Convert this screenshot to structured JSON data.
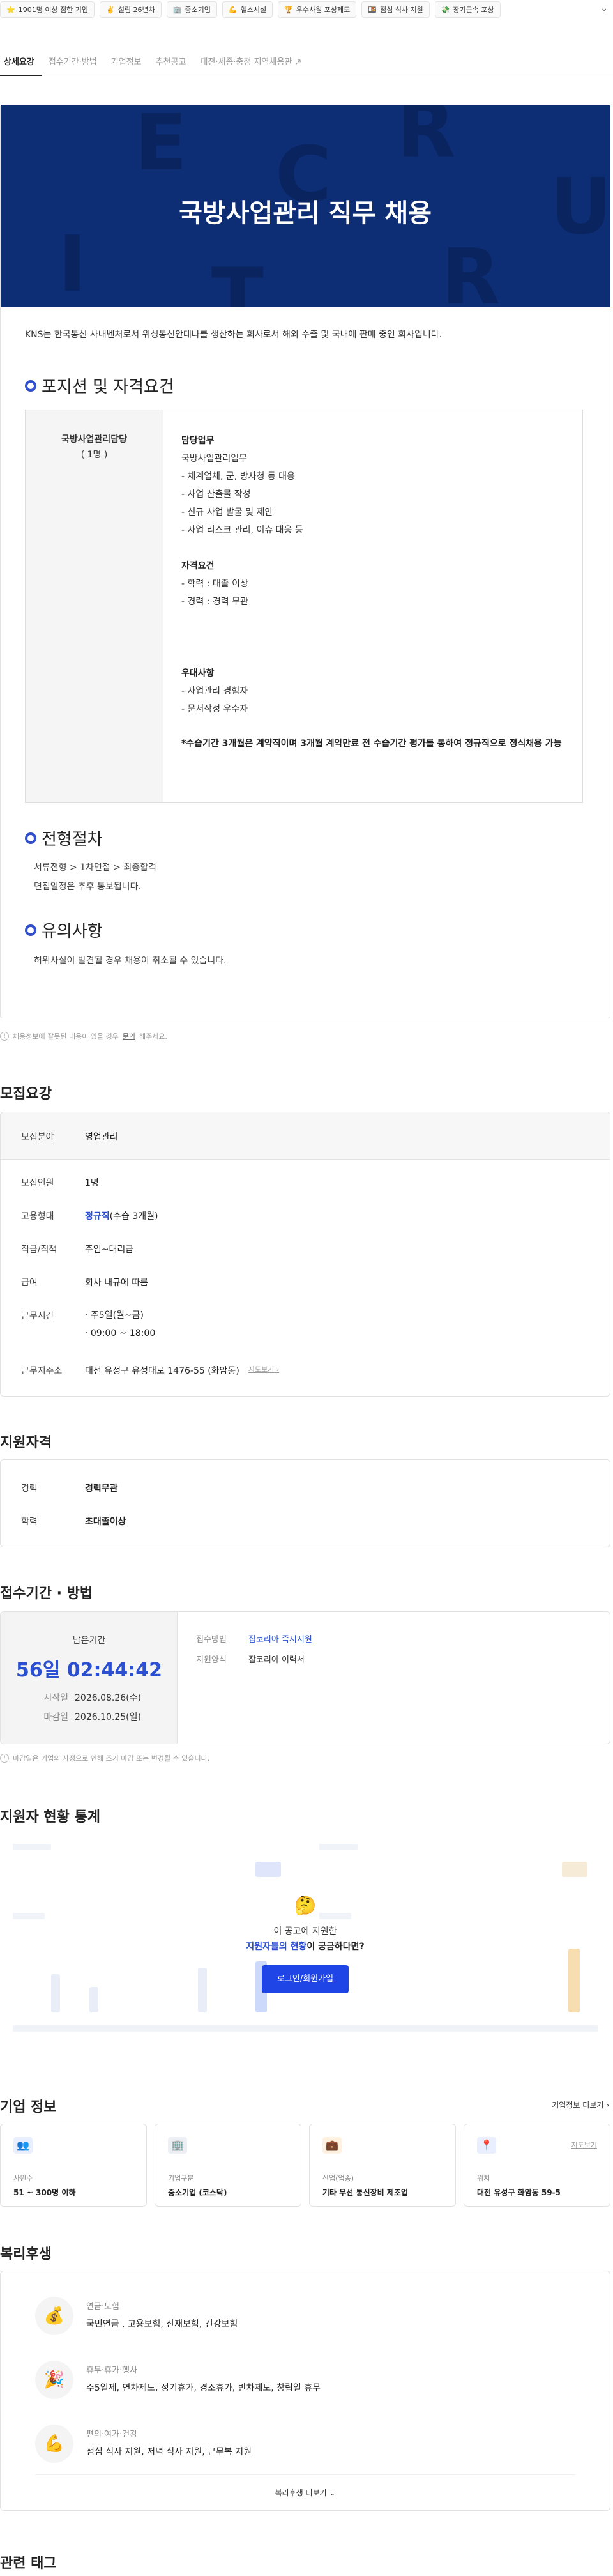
{
  "chips": [
    {
      "icon": "star-icon",
      "glyph": "⭐",
      "label": "1901명 이상 점한 기업"
    },
    {
      "icon": "hand-icon",
      "glyph": "✌️",
      "label": "설립 26년차"
    },
    {
      "icon": "building-icon",
      "glyph": "🏢",
      "label": "중소기업"
    },
    {
      "icon": "muscle-icon",
      "glyph": "💪",
      "label": "헬스시설"
    },
    {
      "icon": "trophy-icon",
      "glyph": "🏆",
      "label": "우수사원 포상제도"
    },
    {
      "icon": "meal-icon",
      "glyph": "🍱",
      "label": "점심 식사 지원"
    },
    {
      "icon": "money-icon",
      "glyph": "💸",
      "label": "장기근속 포상"
    }
  ],
  "tabs": [
    "상세요강",
    "접수기간·방법",
    "기업정보",
    "추천공고",
    "대전·세종·충청 지역채용관"
  ],
  "detail": {
    "banner_title": "국방사업관리 직무  채용",
    "intro": "KNS는 한국통신 사내벤처로서 위성통신안테나를 생산하는 회사로서 해외 수출 및 국내에 판매 중인 회사입니다.",
    "position_heading": "포지션 및 자격요건",
    "position_name": "국방사업관리담당",
    "position_count": "( 1명 )",
    "duty_title": "담당업무",
    "duty_lines": [
      "국방사업관리업무",
      "- 체계업체, 군, 방사청 등 대응",
      "- 사업 산출물 작성",
      "- 신규 사업 발굴 및 제안",
      "- 사업 리스크 관리, 이슈 대응 등"
    ],
    "qual_title": "자격요건",
    "qual_lines": [
      "- 학력 : 대졸 이상",
      "- 경력 : 경력 무관"
    ],
    "pref_title": "우대사항",
    "pref_lines": [
      "- 사업관리 경험자",
      "- 문서작성 우수자"
    ],
    "note": "*수습기간 3개월은 계약직이며 3개월 계약만료 전 수습기간 평가를 통하여 정규직으로 정식채용 가능",
    "process_heading": "전형절차",
    "process_lines": [
      "서류전형 > 1차면접 > 최종합격",
      "면접일정은 추후 통보됩니다."
    ],
    "caution_heading": "유의사항",
    "caution_lines": [
      "허위사실이 발견될 경우 채용이 취소될 수 있습니다."
    ]
  },
  "report_notice": {
    "text": "채용정보에 잘못된 내용이 있을 경우",
    "link": "문의",
    "tail": "해주세요."
  },
  "summary": {
    "heading": "모집요강",
    "rows": [
      {
        "k": "모집분야",
        "v": "영업관리"
      },
      {
        "k": "모집인원",
        "v": "1명"
      },
      {
        "k": "고용형태",
        "v": "정규직",
        "v2": "(수습 3개월)"
      },
      {
        "k": "직급/직책",
        "v": "주임~대리급"
      },
      {
        "k": "급여",
        "v": "회사 내규에 따름"
      },
      {
        "k": "근무시간",
        "v": "· 주5일(월~금)",
        "v2": "· 09:00 ~ 18:00"
      },
      {
        "k": "근무지주소",
        "v": "대전 유성구 유성대로 1476-55 (화암동)",
        "map": "지도보기"
      }
    ]
  },
  "qualification": {
    "heading": "지원자격",
    "rows": [
      {
        "k": "경력",
        "v": "경력무관"
      },
      {
        "k": "학력",
        "v": "초대졸이상"
      }
    ]
  },
  "period": {
    "heading": "접수기간 · 방법",
    "remain_label": "남은기간",
    "remain_time": "56일 02:44:42",
    "start_label": "시작일",
    "start": "2026.08.26(수)",
    "end_label": "마감일",
    "end": "2026.10.25(일)",
    "method_label": "접수방법",
    "method": "잡코리아 즉시지원",
    "form_label": "지원양식",
    "form": "잡코리아 이력서",
    "notice": "마감일은 기업의 사정으로 인해 조기 마감 또는 변경될 수 있습니다."
  },
  "stats": {
    "heading": "지원자 현황 통계",
    "msg1": "이 공고에 지원한",
    "msg2_blue": "지원자들의 현황",
    "msg2_tail": "이 궁금하다면?",
    "login": "로그인/회원가입"
  },
  "company": {
    "heading": "기업 정보",
    "more": "기업정보 더보기",
    "cards": [
      {
        "icon": "people-icon",
        "label": "사원수",
        "value": "51 ~ 300명 이하"
      },
      {
        "icon": "building-icon",
        "label": "기업구분",
        "value": "중소기업 (코스닥)"
      },
      {
        "icon": "briefcase-icon",
        "label": "산업(업종)",
        "value": "기타 무선 통신장비 제조업"
      },
      {
        "icon": "pin-icon",
        "label": "위치",
        "value": "대전 유성구 화암동 59-5",
        "map": "지도보기"
      }
    ]
  },
  "welfare": {
    "heading": "복리후생",
    "items": [
      {
        "icon": "pension-icon",
        "glyph": "💰",
        "title": "연금·보험",
        "desc": "국민연금 , 고용보험, 산재보험, 건강보험"
      },
      {
        "icon": "party-icon",
        "glyph": "🎉",
        "title": "휴무·휴가·행사",
        "desc": "주5일제, 연차제도, 정기휴가, 경조휴가, 반차제도, 창립일 휴무"
      },
      {
        "icon": "muscle-icon",
        "glyph": "💪",
        "title": "편의·여가·건강",
        "desc": "점심 식사 지원, 저녁 식사 지원, 근무복 지원"
      }
    ],
    "more": "복리후생 더보기"
  },
  "tags_heading": "관련 태그"
}
